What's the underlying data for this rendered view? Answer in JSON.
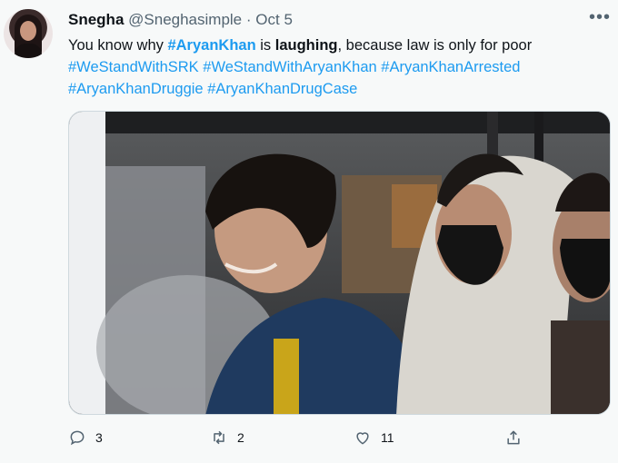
{
  "author": {
    "name": "Snegha",
    "handle": "@Sneghasimple",
    "separator": "·",
    "date": "Oct 5"
  },
  "more_label": "•••",
  "tweet": {
    "t1": "You know why ",
    "h1": "#AryanKhan",
    "t2": " is ",
    "t3": "laughing",
    "t4": ", because law is only for poor",
    "h2": "#WeStandWithSRK",
    "h3": "#WeStandWithAryanKhan",
    "h4": "#AryanKhanArrested",
    "h5": "#AryanKhanDruggie",
    "h6": "#AryanKhanDrugCase"
  },
  "actions": {
    "reply_count": "3",
    "retweet_count": "2",
    "like_count": "11"
  },
  "colors": {
    "accent": "#1d9bf0",
    "muted": "#536471",
    "background": "#f7f9f9"
  }
}
